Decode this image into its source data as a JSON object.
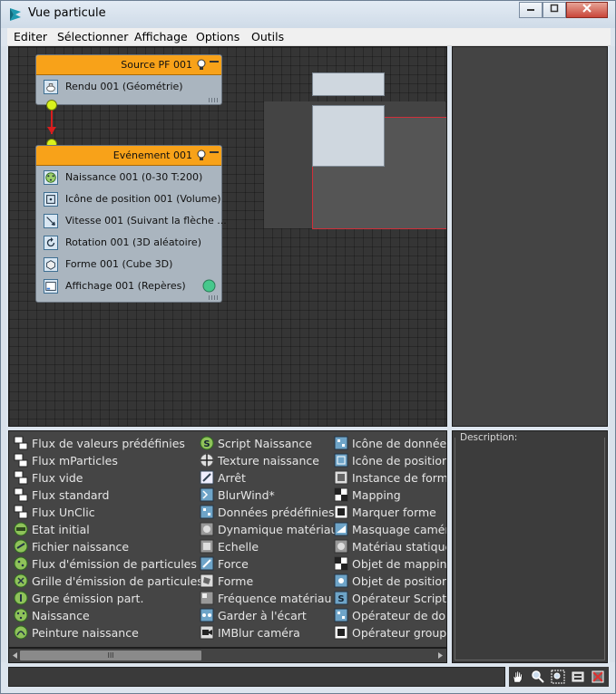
{
  "window": {
    "title": "Vue particule"
  },
  "menu": [
    "Editer",
    "Sélectionner",
    "Affichage",
    "Options",
    "Outils"
  ],
  "nodes": {
    "source": {
      "title": "Source PF 001",
      "operators": [
        "Rendu 001 (Géométrie)"
      ]
    },
    "event": {
      "title": "Evénement 001",
      "operators": [
        "Naissance 001 (0-30 T:200)",
        "Icône de position 001 (Volume)",
        "Vitesse 001 (Suivant la flèche ...",
        "Rotation 001 (3D aléatoire)",
        "Forme 001 (Cube 3D)",
        "Affichage 001 (Repères)"
      ]
    }
  },
  "depot": {
    "col1": [
      "Flux de valeurs prédéfinies",
      "Flux mParticles",
      "Flux vide",
      "Flux standard",
      "Flux UnClic",
      "Etat initial",
      "Fichier naissance",
      "Flux d'émission de particules",
      "Grille d'émission de particules",
      "Grpe émission part.",
      "Naissance",
      "Peinture naissance"
    ],
    "col2": [
      "Script Naissance",
      "Texture naissance",
      "Arrêt",
      "BlurWind*",
      "Données prédéfinies",
      "Dynamique matériau",
      "Echelle",
      "Force",
      "Forme",
      "Fréquence matériau",
      "Garder à l'écart",
      "IMBlur caméra"
    ],
    "col3": [
      "Icône de données",
      "Icône de position",
      "Instance de forme",
      "Mapping",
      "Marquer forme",
      "Masquage caméra",
      "Matériau statique",
      "Objet de mapping",
      "Objet de position",
      "Opérateur Script",
      "Opérateur de don",
      "Opérateur groupe"
    ]
  },
  "description": {
    "label": "Description:"
  },
  "scrollbar": {
    "thumb_glyph": "III"
  },
  "colors": {
    "node_header": "#f8a219",
    "socket": "#d9f21c",
    "wire": "#d81e1e",
    "graph_bg": "#353535",
    "display_dot": "#46c88c"
  }
}
